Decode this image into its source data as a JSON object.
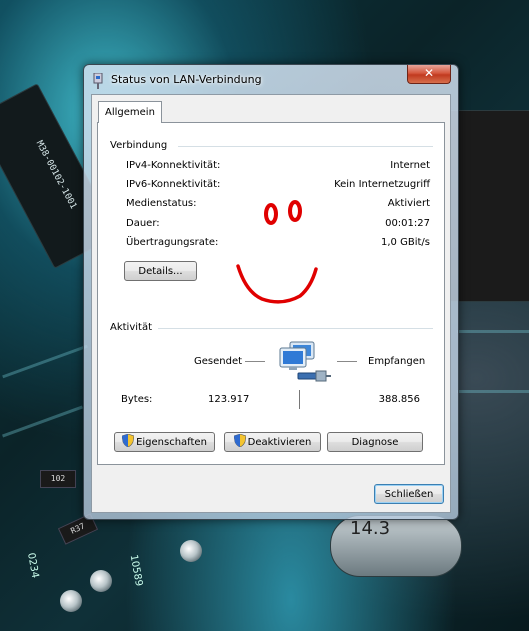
{
  "window": {
    "title": "Status von LAN-Verbindung",
    "close_label": "✕"
  },
  "tabs": [
    {
      "label": "Allgemein"
    }
  ],
  "connection": {
    "group_title": "Verbindung",
    "rows": [
      {
        "label": "IPv4-Konnektivität:",
        "value": "Internet"
      },
      {
        "label": "IPv6-Konnektivität:",
        "value": "Kein Internetzugriff"
      },
      {
        "label": "Medienstatus:",
        "value": "Aktiviert"
      },
      {
        "label": "Dauer:",
        "value": "00:01:27"
      },
      {
        "label": "Übertragungsrate:",
        "value": "1,0 GBit/s"
      }
    ],
    "details_button": "Details..."
  },
  "activity": {
    "group_title": "Aktivität",
    "sent_label": "Gesendet",
    "received_label": "Empfangen",
    "bytes_label": "Bytes:",
    "bytes_sent": "123.917",
    "bytes_received": "388.856"
  },
  "buttons": {
    "properties": "Eigenschaften",
    "deactivate": "Deaktivieren",
    "diagnose": "Diagnose",
    "close": "Schließen"
  },
  "background_text": {
    "chip_marking": "M38-00102-1001",
    "resistor_1": "102",
    "resistor_2": "R37",
    "code_1": "0234",
    "code_2": "10589",
    "crystal": "14.3"
  },
  "colors": {
    "smiley": "#e00000",
    "default_button_border": "#3c7fb1"
  }
}
